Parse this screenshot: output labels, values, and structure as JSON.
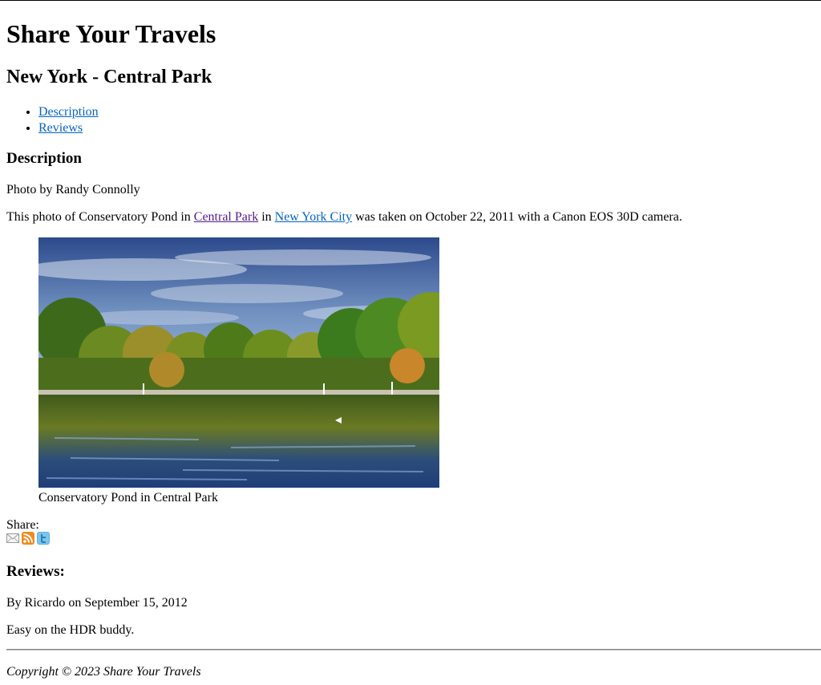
{
  "header": {
    "site_title": "Share Your Travels",
    "page_heading": "New York - Central Park"
  },
  "toc": {
    "items": [
      {
        "label": "Description"
      },
      {
        "label": "Reviews"
      }
    ]
  },
  "description": {
    "heading": "Description",
    "byline": "Photo by Randy Connolly",
    "text_before": "This photo of Conservatory Pond in ",
    "link_park": "Central Park",
    "text_in": " in ",
    "link_city": "New York City",
    "text_after": " was taken on October 22, 2011 with a Canon EOS 30D camera.",
    "figure_caption": "Conservatory Pond in Central Park"
  },
  "share": {
    "label": "Share:",
    "icons": [
      "email-icon",
      "rss-icon",
      "twitter-icon"
    ]
  },
  "reviews": {
    "heading": "Reviews:",
    "items": [
      {
        "byline": "By Ricardo on September 15, 2012",
        "text": "Easy on the HDR buddy."
      }
    ]
  },
  "footer": {
    "copyright": "Copyright © 2023 Share Your Travels"
  },
  "colors": {
    "link": "#0563c1",
    "visited_link": "#551a8b",
    "rss": "#f08a1c",
    "twitter": "#5bb3e3"
  }
}
